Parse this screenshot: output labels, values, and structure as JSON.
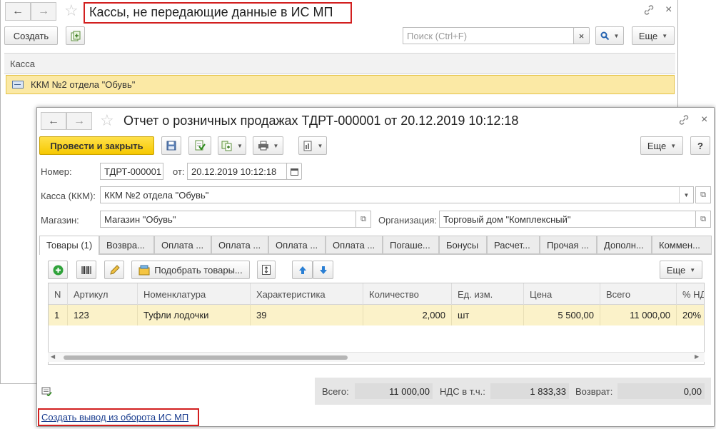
{
  "list_window": {
    "title": "Кассы, не передающие данные в ИС МП",
    "create_label": "Создать",
    "search_placeholder": "Поиск (Ctrl+F)",
    "search_clear": "×",
    "more_label": "Еще",
    "column_kassa": "Касса",
    "rows": [
      {
        "kassa": "ККМ №2 отдела \"Обувь\""
      }
    ]
  },
  "doc_window": {
    "title": "Отчет о розничных продажах ТДРТ-000001 от 20.12.2019 10:12:18",
    "post_close_label": "Провести и закрыть",
    "more_label": "Еще",
    "help_label": "?",
    "fields": {
      "number_label": "Номер:",
      "number_value": "ТДРТ-000001",
      "date_label": "от:",
      "date_value": "20.12.2019 10:12:18",
      "kassa_label": "Касса (ККМ):",
      "kassa_value": "ККМ №2 отдела \"Обувь\"",
      "shop_label": "Магазин:",
      "shop_value": "Магазин \"Обувь\"",
      "org_label": "Организация:",
      "org_value": "Торговый дом \"Комплексный\""
    },
    "tabs": [
      "Товары (1)",
      "Возвра...",
      "Оплата ...",
      "Оплата ...",
      "Оплата ...",
      "Оплата ...",
      "Погаше...",
      "Бонусы",
      "Расчет...",
      "Прочая ...",
      "Дополн...",
      "Коммен..."
    ],
    "table_toolbar": {
      "pick_goods_label": "Подобрать товары...",
      "more_label": "Еще"
    },
    "table": {
      "columns": [
        "N",
        "Артикул",
        "Номенклатура",
        "Характеристика",
        "Количество",
        "Ед. изм.",
        "Цена",
        "Всего",
        "% НД"
      ],
      "rows": [
        {
          "n": "1",
          "article": "123",
          "nomenclature": "Туфли лодочки",
          "characteristic": "39",
          "quantity": "2,000",
          "unit": "шт",
          "price": "5 500,00",
          "total": "11 000,00",
          "vat": "20%"
        }
      ]
    },
    "totals": {
      "total_label": "Всего:",
      "total_value": "11 000,00",
      "vat_label": "НДС в т.ч.:",
      "vat_value": "1 833,33",
      "return_label": "Возврат:",
      "return_value": "0,00"
    },
    "create_link": "Создать вывод из оборота ИС МП"
  },
  "icons": {
    "back": "←",
    "forward": "→",
    "star": "☆",
    "link": "🔗",
    "close": "×"
  },
  "colors": {
    "selection": "#fbe9a5",
    "primary_button": "#f6c800",
    "highlight_border": "#d21f1f",
    "link": "#1a3d8f"
  }
}
